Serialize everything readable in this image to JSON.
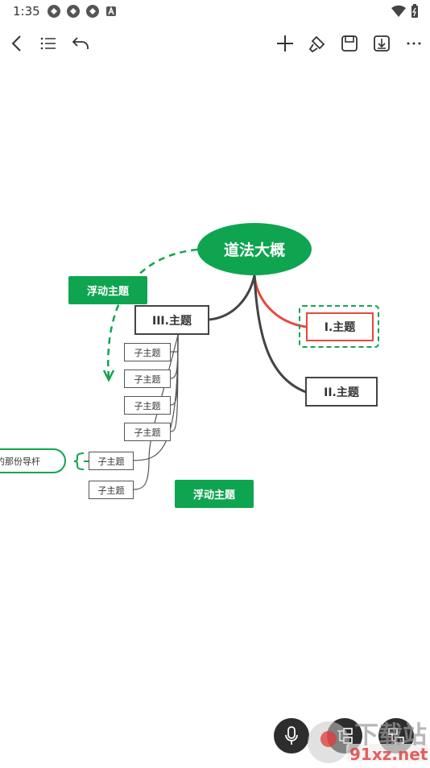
{
  "status_bar": {
    "time": "1:35"
  },
  "mindmap": {
    "root": "道法大概",
    "branches": [
      {
        "label": "I.主题",
        "selected": true
      },
      {
        "label": "II.主题"
      },
      {
        "label": "III.主题",
        "children": [
          "子主题",
          "子主题",
          "子主题",
          "子主题"
        ]
      }
    ],
    "extra_subtopics": [
      "子主题",
      "子主题"
    ],
    "floating_topics": [
      "浮动主题",
      "浮动主题"
    ],
    "outline_topic": "费的那份导杆"
  },
  "colors": {
    "accent": "#0fa550",
    "selected_branch": "#e8483f",
    "branch_line": "#444444"
  },
  "watermark": {
    "brand": "下载站",
    "domain": "91xz.net"
  }
}
